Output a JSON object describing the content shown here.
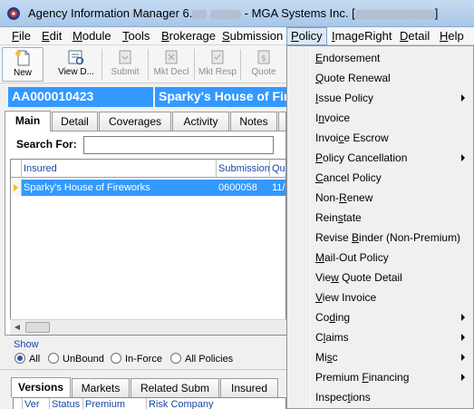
{
  "window": {
    "title_prefix": "Agency Information Manager 6.",
    "title_mid": "MGA Systems Inc. [",
    "title_suffix": "]"
  },
  "menubar": [
    {
      "label": "File",
      "key": "F",
      "rest": "ile"
    },
    {
      "label": "Edit",
      "key": "E",
      "rest": "dit"
    },
    {
      "label": "Module",
      "key": "M",
      "rest": "odule"
    },
    {
      "label": "Tools",
      "key": "T",
      "rest": "ools"
    },
    {
      "label": "Brokerage",
      "key": "B",
      "rest": "rokerage"
    },
    {
      "label": "Submission",
      "key": "S",
      "rest": "ubmission"
    },
    {
      "label": "Policy",
      "key": "P",
      "rest": "olicy"
    },
    {
      "label": "ImageRight",
      "key": "I",
      "rest": "mageRight"
    },
    {
      "label": "Detail",
      "key": "D",
      "rest": "etail"
    },
    {
      "label": "Help",
      "key": "H",
      "rest": "elp"
    }
  ],
  "toolbar": {
    "new": "New",
    "view": "View D...",
    "submit": "Submit",
    "mkt_decl": "Mkt Decl",
    "mkt_resp": "Mkt Resp",
    "quote": "Quote"
  },
  "record": {
    "id": "AA000010423",
    "name": "Sparky's House of Firew"
  },
  "tabs": [
    "Main",
    "Detail",
    "Coverages",
    "Activity",
    "Notes"
  ],
  "search": {
    "label": "Search For:",
    "value": ""
  },
  "grid": {
    "headers": [
      "Insured",
      "Submission",
      "Qu"
    ],
    "row": {
      "insured": "Sparky's House of Fireworks",
      "submission": "0600058",
      "qu": "11/"
    }
  },
  "show": {
    "label": "Show",
    "options": [
      "All",
      "UnBound",
      "In-Force",
      "All Policies"
    ],
    "selected": "All"
  },
  "bottom_tabs": [
    "Versions",
    "Markets",
    "Related Subm",
    "Insured"
  ],
  "bottom_grid_headers": [
    "Ver",
    "Status",
    "Premium",
    "Risk Company"
  ],
  "policy_menu": [
    {
      "pre": "",
      "key": "E",
      "post": "ndorsement",
      "submenu": false
    },
    {
      "pre": "",
      "key": "Q",
      "post": "uote Renewal",
      "submenu": false
    },
    {
      "pre": "",
      "key": "I",
      "post": "ssue Policy",
      "submenu": true
    },
    {
      "pre": "I",
      "key": "n",
      "post": "voice",
      "submenu": false
    },
    {
      "pre": "Invoi",
      "key": "c",
      "post": "e Escrow",
      "submenu": false
    },
    {
      "pre": "",
      "key": "P",
      "post": "olicy Cancellation",
      "submenu": true
    },
    {
      "pre": "",
      "key": "C",
      "post": "ancel Policy",
      "submenu": false
    },
    {
      "pre": "Non-",
      "key": "R",
      "post": "enew",
      "submenu": false
    },
    {
      "pre": "Rein",
      "key": "s",
      "post": "tate",
      "submenu": false
    },
    {
      "pre": "Revise ",
      "key": "B",
      "post": "inder (Non-Premium)",
      "submenu": false
    },
    {
      "pre": "",
      "key": "M",
      "post": "ail-Out Policy",
      "submenu": false
    },
    {
      "pre": "Vie",
      "key": "w",
      "post": " Quote Detail",
      "submenu": false
    },
    {
      "pre": "",
      "key": "V",
      "post": "iew Invoice",
      "submenu": false
    },
    {
      "pre": "Co",
      "key": "d",
      "post": "ing",
      "submenu": true
    },
    {
      "pre": "C",
      "key": "l",
      "post": "aims",
      "submenu": true
    },
    {
      "pre": "Mi",
      "key": "s",
      "post": "c",
      "submenu": true
    },
    {
      "pre": "Premium ",
      "key": "F",
      "post": "inancing",
      "submenu": true
    },
    {
      "pre": "Inspec",
      "key": "t",
      "post": "ions",
      "submenu": false
    }
  ]
}
